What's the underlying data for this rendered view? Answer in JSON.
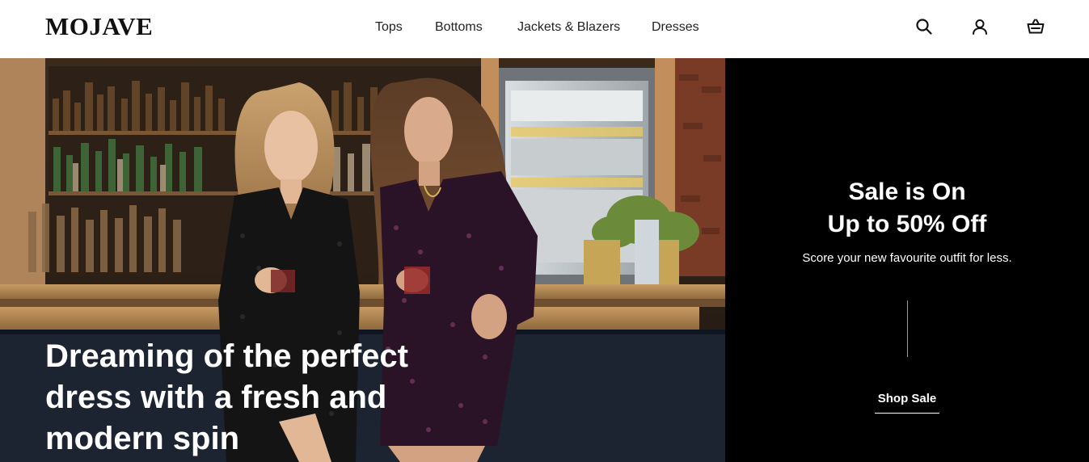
{
  "brand": {
    "logo": "MOJAVE"
  },
  "nav": {
    "items": [
      "Tops",
      "Bottoms",
      "Jackets & Blazers",
      "Dresses"
    ]
  },
  "header_icons": [
    "search-icon",
    "account-icon",
    "cart-icon"
  ],
  "hero": {
    "title": "Dreaming of the perfect dress with a fresh and modern spin"
  },
  "promo": {
    "headline_line1": "Sale is On",
    "headline_line2": "Up to 50% Off",
    "subtext": "Score your new favourite outfit for less.",
    "cta_label": "Shop Sale"
  },
  "colors": {
    "header_bg": "#ffffff",
    "promo_bg": "#000000",
    "text_dark": "#111111",
    "text_light": "#ffffff"
  }
}
